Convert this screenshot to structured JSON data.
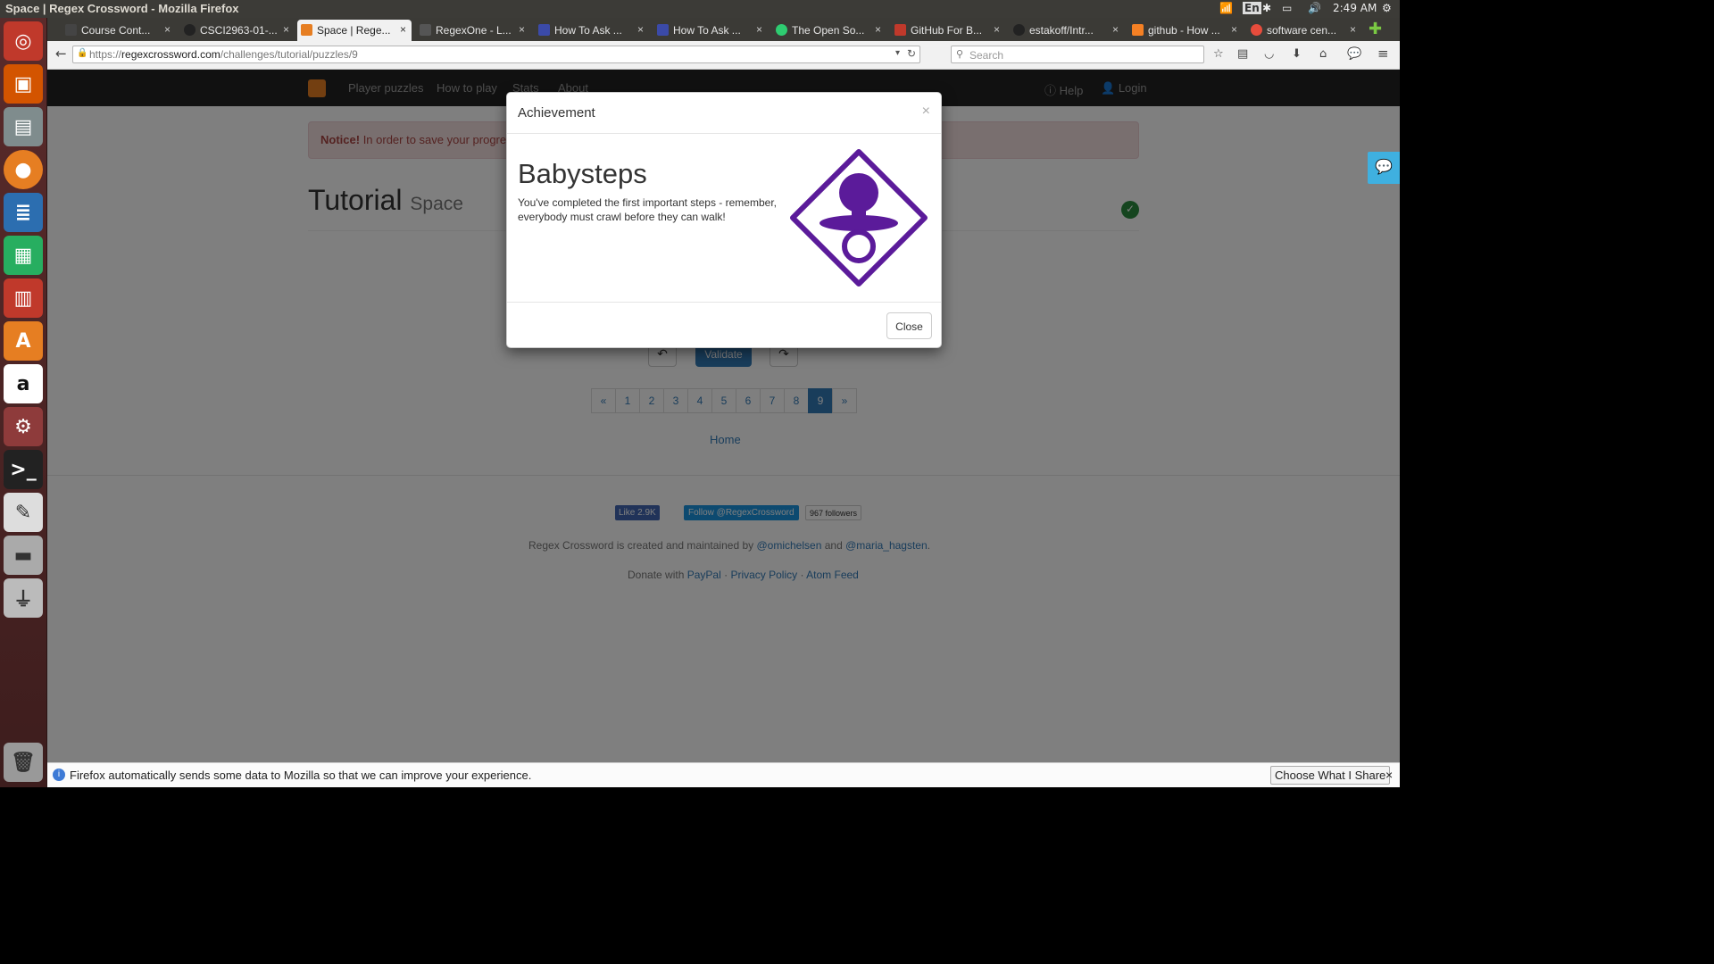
{
  "os": {
    "window_title": "Space | Regex Crossword - Mozilla Firefox",
    "lang_indicator": "En",
    "clock": "2:49 AM"
  },
  "browser": {
    "tabs": [
      {
        "label": "Course Cont..."
      },
      {
        "label": "CSCI2963-01-..."
      },
      {
        "label": "Space | Rege..."
      },
      {
        "label": "RegexOne - L..."
      },
      {
        "label": "How To Ask ..."
      },
      {
        "label": "How To Ask ..."
      },
      {
        "label": "The Open So..."
      },
      {
        "label": "GitHub For B..."
      },
      {
        "label": "estakoff/Intr..."
      },
      {
        "label": "github - How ..."
      },
      {
        "label": "software cen..."
      }
    ],
    "url_prefix": "https://",
    "url_host": "regexcrossword.com",
    "url_path": "/challenges/tutorial/puzzles/9",
    "search_placeholder": "Search",
    "infobar_text": "Firefox automatically sends some data to Mozilla so that we can improve your experience.",
    "infobar_button": "Choose What I Share"
  },
  "site": {
    "nav": [
      "Player puzzles",
      "How to play",
      "Stats",
      "About"
    ],
    "help": "Help",
    "login": "Login",
    "notice_bold": "Notice!",
    "notice_text": "In order to save your progress y",
    "title": "Tutorial",
    "subtitle": "Space",
    "validate": "Validate",
    "pagination": [
      "«",
      "1",
      "2",
      "3",
      "4",
      "5",
      "6",
      "7",
      "8",
      "9",
      "»"
    ],
    "active_page": "9",
    "home_link": "Home",
    "fb_like": "Like 2.9K",
    "twitter_follow": "Follow @RegexCrossword",
    "followers": "967 followers",
    "credits_pre": "Regex Crossword is created and maintained by",
    "credits_user1": "@omichelsen",
    "credits_and": "and",
    "credits_user2": "@maria_hagsten",
    "credits_end": ".",
    "donate_pre": "Donate with",
    "paypal": "PayPal",
    "privacy": "Privacy Policy",
    "atom": "Atom Feed",
    "sep": "·"
  },
  "modal": {
    "title": "Achievement",
    "close_x": "×",
    "heading": "Babysteps",
    "description": "You've completed the first important steps - remember, everybody must crawl before they can walk!",
    "close_button": "Close",
    "badge_color": "#5b1b9a"
  }
}
